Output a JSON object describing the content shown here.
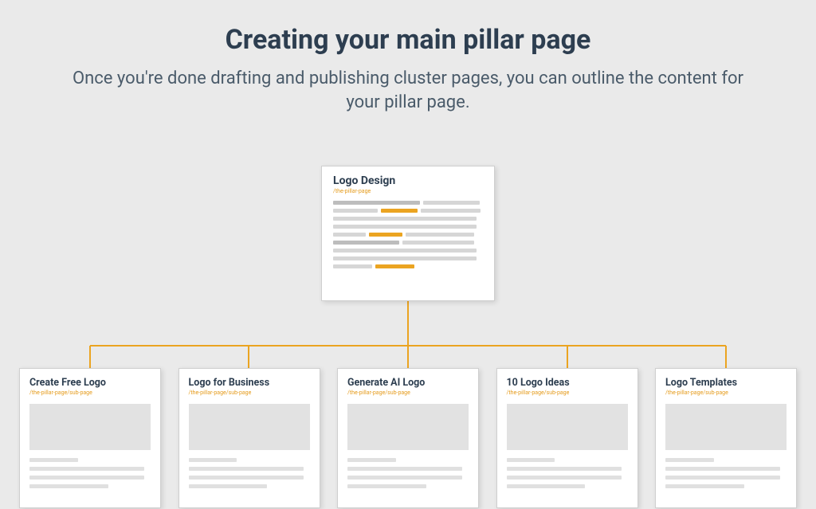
{
  "header": {
    "title": "Creating your main pillar page",
    "subtitle": "Once you're done drafting and publishing cluster pages, you can outline the content for your pillar page."
  },
  "pillar": {
    "title": "Logo Design",
    "path": "/the-pillar-page"
  },
  "subpages": [
    {
      "title": "Create Free Logo",
      "path": "/the-pillar-page/sub-page"
    },
    {
      "title": "Logo for Business",
      "path": "/the-pillar-page/sub-page"
    },
    {
      "title": "Generate AI Logo",
      "path": "/the-pillar-page/sub-page"
    },
    {
      "title": "10 Logo Ideas",
      "path": "/the-pillar-page/sub-page"
    },
    {
      "title": "Logo Templates",
      "path": "/the-pillar-page/sub-page"
    }
  ],
  "colors": {
    "accent": "#eba421",
    "heading": "#2d3e50",
    "text": "#4a5b6a"
  }
}
